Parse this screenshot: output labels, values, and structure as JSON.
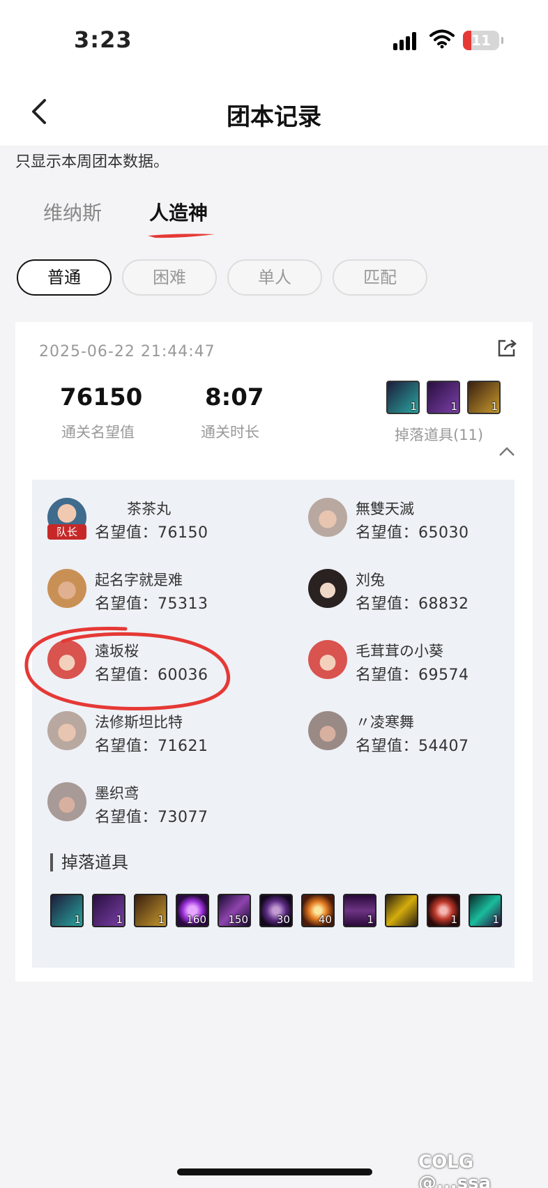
{
  "status_bar": {
    "time": "3:23",
    "battery": "11",
    "battery_color": "#e53935"
  },
  "nav": {
    "title": "团本记录"
  },
  "notice": "只显示本周团本数据。",
  "raid_tabs": [
    {
      "label": "维纳斯",
      "active": false
    },
    {
      "label": "人造神",
      "active": true
    }
  ],
  "difficulty": [
    {
      "label": "普通",
      "active": true
    },
    {
      "label": "困难",
      "active": false
    },
    {
      "label": "单人",
      "active": false
    },
    {
      "label": "匹配",
      "active": false
    }
  ],
  "record": {
    "datetime": "2025-06-22 21:44:47",
    "reputation_value": "76150",
    "reputation_label": "通关名望值",
    "duration_value": "8:07",
    "duration_label": "通关时长",
    "drops_label": "掉落道具(11)",
    "drops_preview": [
      {
        "icon": "weapon-drop-icon",
        "count": "1",
        "color": "#2aa7a0"
      },
      {
        "icon": "axe-drop-icon",
        "count": "1",
        "color": "#7a3fa8"
      },
      {
        "icon": "gauntlet-drop-icon",
        "count": "1",
        "color": "#c89a2e"
      }
    ]
  },
  "members": [
    {
      "name": "茶茶丸",
      "rep_label": "名望值：",
      "rep": "76150",
      "leader": true,
      "leader_label": "队长",
      "color": "#3f6b8c"
    },
    {
      "name": "無雙天滅",
      "rep_label": "名望值：",
      "rep": "65030",
      "leader": false,
      "color": "#b8a8a0"
    },
    {
      "name": "起名字就是难",
      "rep_label": "名望值：",
      "rep": "75313",
      "leader": false,
      "color": "#c99055"
    },
    {
      "name": "刘兔",
      "rep_label": "名望值：",
      "rep": "68832",
      "leader": false,
      "color": "#2a2220"
    },
    {
      "name": "遠坂桜",
      "rep_label": "名望值：",
      "rep": "60036",
      "leader": false,
      "color": "#d9534f"
    },
    {
      "name": "毛茸茸の小葵",
      "rep_label": "名望值：",
      "rep": "69574",
      "leader": false,
      "color": "#d9534f"
    },
    {
      "name": "法修斯坦比特",
      "rep_label": "名望值：",
      "rep": "71621",
      "leader": false,
      "color": "#b8a8a0"
    },
    {
      "name": "〃凌寒舞",
      "rep_label": "名望值：",
      "rep": "54407",
      "leader": false,
      "color": "#9a8a86"
    },
    {
      "name": "墨织鸢",
      "rep_label": "名望值：",
      "rep": "73077",
      "leader": false,
      "color": "#a89a96"
    }
  ],
  "drops_section": {
    "title": "掉落道具",
    "items": [
      {
        "icon": "weapon-drop-icon",
        "count": "1",
        "color": "#2aa7a0"
      },
      {
        "icon": "axe-drop-icon",
        "count": "1",
        "color": "#7a3fa8"
      },
      {
        "icon": "gauntlet-drop-icon",
        "count": "1",
        "color": "#c89a2e"
      },
      {
        "icon": "purple-orb-icon",
        "count": "160",
        "color": "#9b30d9"
      },
      {
        "icon": "crystal-icon",
        "count": "150",
        "color": "#8e44ad"
      },
      {
        "icon": "dark-orb-icon",
        "count": "30",
        "color": "#5b2c83"
      },
      {
        "icon": "eye-relic-icon",
        "count": "40",
        "color": "#e67e22"
      },
      {
        "icon": "chest-icon",
        "count": "1",
        "color": "#6c3483"
      },
      {
        "icon": "key-icon",
        "count": "",
        "color": "#d4ac0d"
      },
      {
        "icon": "red-gem-box-icon",
        "count": "1",
        "color": "#c0392b"
      },
      {
        "icon": "green-blade-icon",
        "count": "1",
        "color": "#1abc9c"
      }
    ]
  },
  "watermark": "COLG @...ssa"
}
